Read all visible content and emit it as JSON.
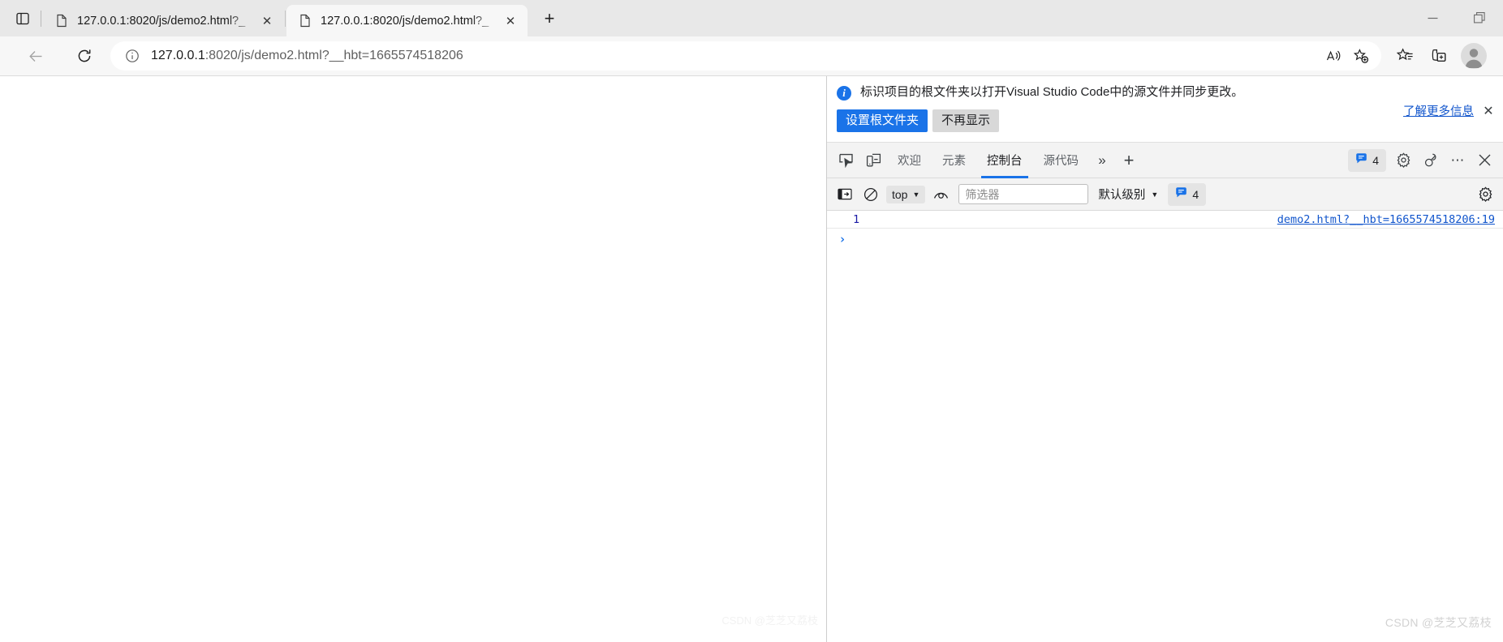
{
  "browser": {
    "tabs": [
      {
        "title": "127.0.0.1:8020/js/demo2.html?_",
        "favicon": "document-icon",
        "active": false,
        "close_label": "✕"
      },
      {
        "title": "127.0.0.1:8020/js/demo2.html?_",
        "favicon": "document-icon",
        "active": true,
        "close_label": "✕"
      }
    ],
    "new_tab_label": "+",
    "window_controls": {
      "minimize": "—",
      "maximize": "restore-icon",
      "close": ""
    },
    "toolbar": {
      "back_label": "←",
      "reload_label": "↻",
      "url_host": "127.0.0.1",
      "url_rest": ":8020/js/demo2.html?__hbt=1665574518206",
      "url_full": "127.0.0.1:8020/js/demo2.html?__hbt=1665574518206",
      "icons": [
        "read-aloud-icon",
        "add-favorite-icon",
        "favorites-icon",
        "collections-icon",
        "profile-avatar"
      ]
    }
  },
  "infobar": {
    "icon": "info-icon",
    "message": "标识项目的根文件夹以打开Visual Studio Code中的源文件并同步更改。",
    "primary_button": "设置根文件夹",
    "secondary_button": "不再显示",
    "learn_more": "了解更多信息",
    "close_label": "✕"
  },
  "devtools": {
    "tabs": [
      {
        "label": "欢迎",
        "selected": false
      },
      {
        "label": "元素",
        "selected": false
      },
      {
        "label": "控制台",
        "selected": true
      },
      {
        "label": "源代码",
        "selected": false
      }
    ],
    "more_tabs_label": "»",
    "add_tab_label": "+",
    "issues_count": "4",
    "close_label": "✕",
    "left_icons": [
      "inspect-element-icon",
      "device-toolbar-icon"
    ],
    "right_icons": [
      "settings-gear-icon",
      "customize-devtools-icon",
      "more-options-icon",
      "close-devtools-icon"
    ],
    "console_toolbar": {
      "sidebar_icon": "console-sidebar-icon",
      "clear_icon": "clear-console-icon",
      "context_value": "top",
      "context_caret": "▼",
      "eye_icon": "live-expression-eye-icon",
      "filter_placeholder": "筛选器",
      "filter_value": "",
      "level_label": "默认级别",
      "level_caret": "▼",
      "issues_count": "4",
      "settings_icon": "console-settings-gear-icon"
    },
    "console_rows": [
      {
        "value": "1",
        "source": "demo2.html?__hbt=1665574518206:19"
      }
    ],
    "prompt_caret": "›"
  },
  "watermark": "CSDN @芝芝又荔枝",
  "colors": {
    "accent_blue": "#1a73e8",
    "link_blue": "#1155cc",
    "tab_active_bg": "#f7f7f7",
    "tabstrip_bg": "#e8e8e8",
    "devtools_bg": "#f3f3f3"
  }
}
